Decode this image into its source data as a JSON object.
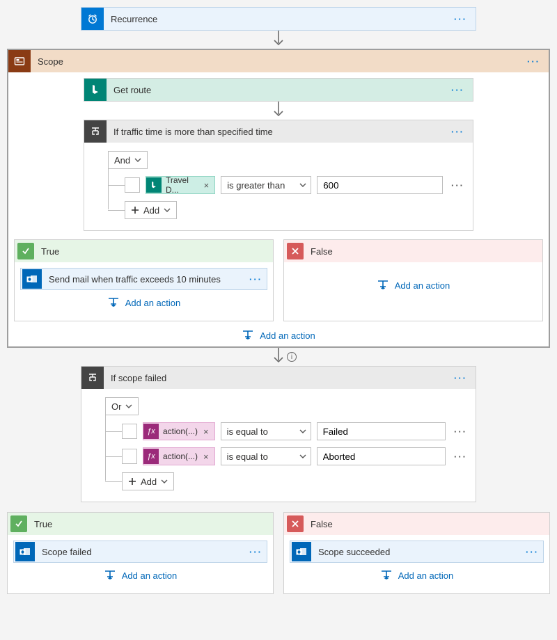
{
  "recurrence": {
    "label": "Recurrence"
  },
  "scope": {
    "label": "Scope"
  },
  "getRoute": {
    "label": "Get route"
  },
  "cond1": {
    "title": "If traffic time is more than specified time",
    "group": "And",
    "row": {
      "token": "Travel D...",
      "op": "is greater than",
      "value": "600"
    },
    "add": "Add"
  },
  "branch1": {
    "true": {
      "label": "True",
      "action": "Send mail when traffic exceeds 10 minutes"
    },
    "false": {
      "label": "False"
    }
  },
  "addAction": "Add an action",
  "cond2": {
    "title": "If scope failed",
    "group": "Or",
    "rows": [
      {
        "token": "action(...)",
        "op": "is equal to",
        "value": "Failed"
      },
      {
        "token": "action(...)",
        "op": "is equal to",
        "value": "Aborted"
      }
    ],
    "add": "Add"
  },
  "branch2": {
    "true": {
      "label": "True",
      "action": "Scope failed"
    },
    "false": {
      "label": "False",
      "action": "Scope succeeded"
    }
  }
}
